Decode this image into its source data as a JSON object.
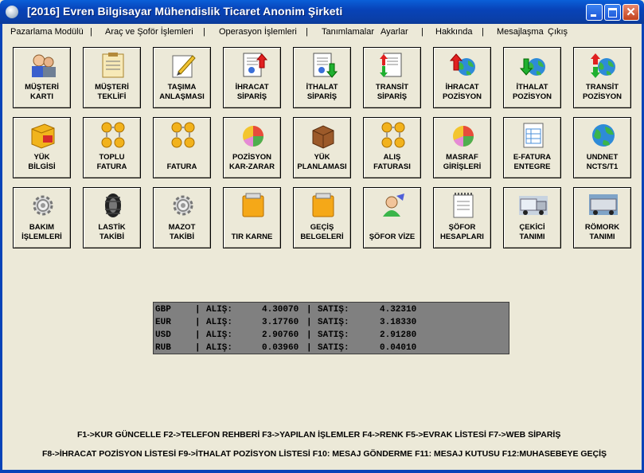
{
  "window": {
    "title": "[2016] Evren Bilgisayar Mühendislik Ticaret Anonim Şirketi"
  },
  "menu": [
    "Pazarlama Modülü",
    "Araç ve Şoför İşlemleri",
    "Operasyon İşlemleri",
    "Tanımlamalar",
    "Ayarlar",
    "Hakkında",
    "Mesajlaşma",
    "Çıkış"
  ],
  "menu_separator": "|",
  "tiles": [
    [
      {
        "label": "MÜŞTERİ\nKARTI",
        "icon": "customer-card-icon"
      },
      {
        "label": "MÜŞTERİ\nTEKLİFİ",
        "icon": "customer-offer-icon"
      },
      {
        "label": "TAŞIMA\nANLAŞMASI",
        "icon": "transport-agreement-icon"
      },
      {
        "label": "İHRACAT\nSİPARİŞ",
        "icon": "export-order-icon"
      },
      {
        "label": "İTHALAT\nSİPARİŞ",
        "icon": "import-order-icon"
      },
      {
        "label": "TRANSİT\nSİPARİŞ",
        "icon": "transit-order-icon"
      },
      {
        "label": "İHRACAT\nPOZİSYON",
        "icon": "export-position-icon"
      },
      {
        "label": "İTHALAT\nPOZİSYON",
        "icon": "import-position-icon"
      },
      {
        "label": "TRANSİT\nPOZİSYON",
        "icon": "transit-position-icon"
      }
    ],
    [
      {
        "label": "YÜK\nBİLGİSİ",
        "icon": "cargo-info-icon"
      },
      {
        "label": "TOPLU\nFATURA",
        "icon": "bulk-invoice-icon"
      },
      {
        "label": "FATURA",
        "icon": "invoice-icon"
      },
      {
        "label": "POZİSYON\nKAR-ZARAR",
        "icon": "position-profit-loss-icon"
      },
      {
        "label": "YÜK\nPLANLAMASI",
        "icon": "cargo-planning-icon"
      },
      {
        "label": "ALIŞ\nFATURASI",
        "icon": "purchase-invoice-icon"
      },
      {
        "label": "MASRAF\nGİRİŞLERİ",
        "icon": "expense-entries-icon"
      },
      {
        "label": "E-FATURA\nENTEGRE",
        "icon": "e-invoice-icon"
      },
      {
        "label": "UNDNET\nNCTS/T1",
        "icon": "undnet-globe-icon"
      }
    ],
    [
      {
        "label": "BAKIM\nİŞLEMLERİ",
        "icon": "maintenance-gear-icon"
      },
      {
        "label": "LASTİK\nTAKİBİ",
        "icon": "tire-icon"
      },
      {
        "label": "MAZOT\nTAKİBİ",
        "icon": "diesel-gear-icon"
      },
      {
        "label": "TIR KARNE",
        "icon": "tir-carnet-icon"
      },
      {
        "label": "GEÇİŞ\nBELGELERİ",
        "icon": "transit-docs-icon"
      },
      {
        "label": "ŞÖFOR VİZE",
        "icon": "driver-visa-icon"
      },
      {
        "label": "ŞÖFOR\nHESAPLARI",
        "icon": "driver-accounts-icon"
      },
      {
        "label": "ÇEKİCİ\nTANIMI",
        "icon": "truck-tractor-icon"
      },
      {
        "label": "RÖMORK\nTANIMI",
        "icon": "trailer-icon"
      }
    ]
  ],
  "rates": [
    {
      "cur": "GBP",
      "buy_label": "ALIŞ:",
      "buy": "4.30070",
      "sell_label": "SATIŞ:",
      "sell": "4.32310"
    },
    {
      "cur": "EUR",
      "buy_label": "ALIŞ:",
      "buy": "3.17760",
      "sell_label": "SATIŞ:",
      "sell": "3.18330"
    },
    {
      "cur": "USD",
      "buy_label": "ALIŞ:",
      "buy": "2.90760",
      "sell_label": "SATIŞ:",
      "sell": "2.91280"
    },
    {
      "cur": "RUB",
      "buy_label": "ALIŞ:",
      "buy": "0.03960",
      "sell_label": "SATIŞ:",
      "sell": "0.04010"
    }
  ],
  "rate_separator": "|",
  "shortcuts": {
    "line1": "F1->KUR GÜNCELLE  F2->TELEFON REHBERİ   F3->YAPILAN İŞLEMLER  F4->RENK  F5->EVRAK LİSTESİ  F7->WEB SİPARİŞ",
    "line2": "F8->İHRACAT POZİSYON LİSTESİ  F9->İTHALAT POZİSYON LİSTESİ   F10: MESAJ GÖNDERME  F11: MESAJ KUTUSU  F12:MUHASEBEYE GEÇİŞ"
  },
  "colors": {
    "titlebar": "#0843b8",
    "background": "#ece9d8",
    "rates_panel": "#808080"
  }
}
